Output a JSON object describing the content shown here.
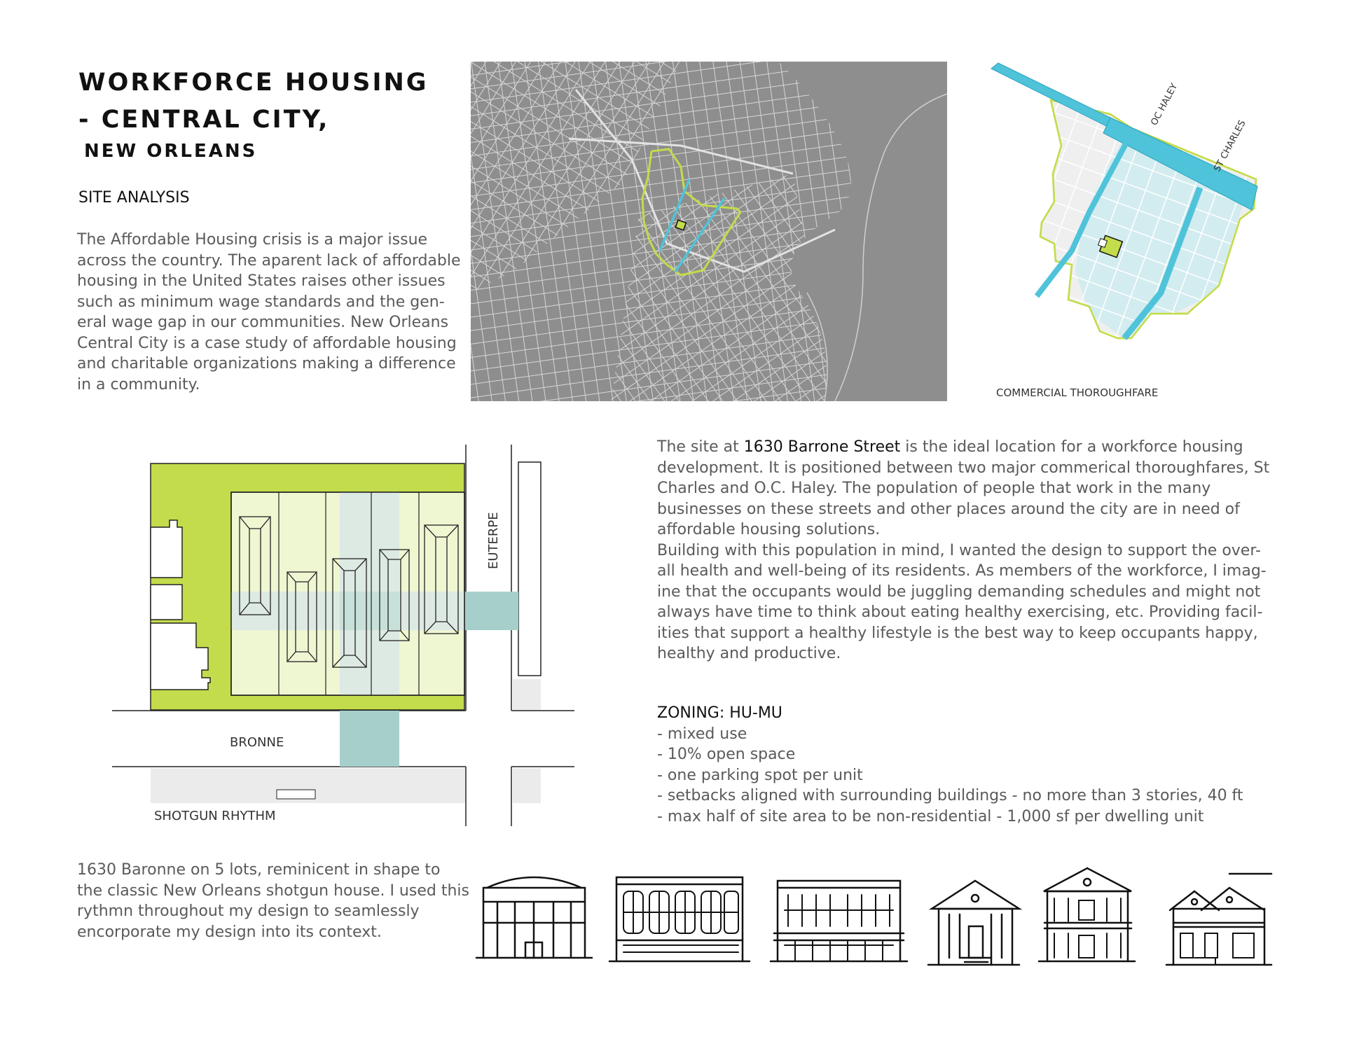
{
  "header": {
    "title_line1": "WORKFORCE HOUSING",
    "title_line2": "- CENTRAL CITY,",
    "title_line3": "NEW ORLEANS",
    "section": "SITE ANALYSIS"
  },
  "intro_paragraph": "The Affordable Housing crisis is a major issue across the country. The aparent lack of affordable housing in the United States raises other issues such as minimum wage standards and the gen-eral wage gap in our communities. New Orleans Central City is a case study of affordable housing and charitable organizations making a difference in a community.",
  "district_map": {
    "street_labels": [
      "OC HALEY",
      "ST CHARLES"
    ],
    "caption": "COMMERCIAL THOROUGHFARE"
  },
  "site_plan": {
    "street_labels": [
      "EUTERPE",
      "BRONNE"
    ],
    "caption": "SHOTGUN RHYTHM"
  },
  "site_description": {
    "before": "The site at ",
    "address": "1630 Barrone Street",
    "after": " is the ideal location for a workforce housing development. It is positioned between two major commerical thoroughfares, St Charles and O.C. Haley. The population of people that work in the many businesses on these streets and other places around the city are in need of affordable housing solutions.",
    "second": "Building with this population in mind, I wanted the design to support the over-all health and well-being of its residents. As members of the workforce, I imag-ine that the occupants would be juggling demanding schedules and might not always have time to think about eating healthy exercising, etc. Providing facil-ities that support a healthy lifestyle is the best way to keep occupants happy, healthy and productive."
  },
  "zoning": {
    "heading": "ZONING: HU-MU",
    "items": [
      "- mixed use",
      "- 10% open space",
      "- one parking spot per unit",
      "- setbacks aligned with surrounding buildings - no more than 3 stories, 40 ft",
      "- max half of site area to be non-residential - 1,000 sf per dwelling unit"
    ]
  },
  "context_paragraph": "1630 Baronne on 5 lots, reminicent in shape to the classic New Orleans shotgun house. I used this rythmn throughout my design to seamlessly encorporate my design into its context.",
  "colors": {
    "map_gray": "#8e8e8e",
    "site_green": "#c3dc4b",
    "highlight_blue": "#4fc3d9",
    "district_fill": "#d3ecef",
    "path_teal": "#a6cfcb"
  }
}
